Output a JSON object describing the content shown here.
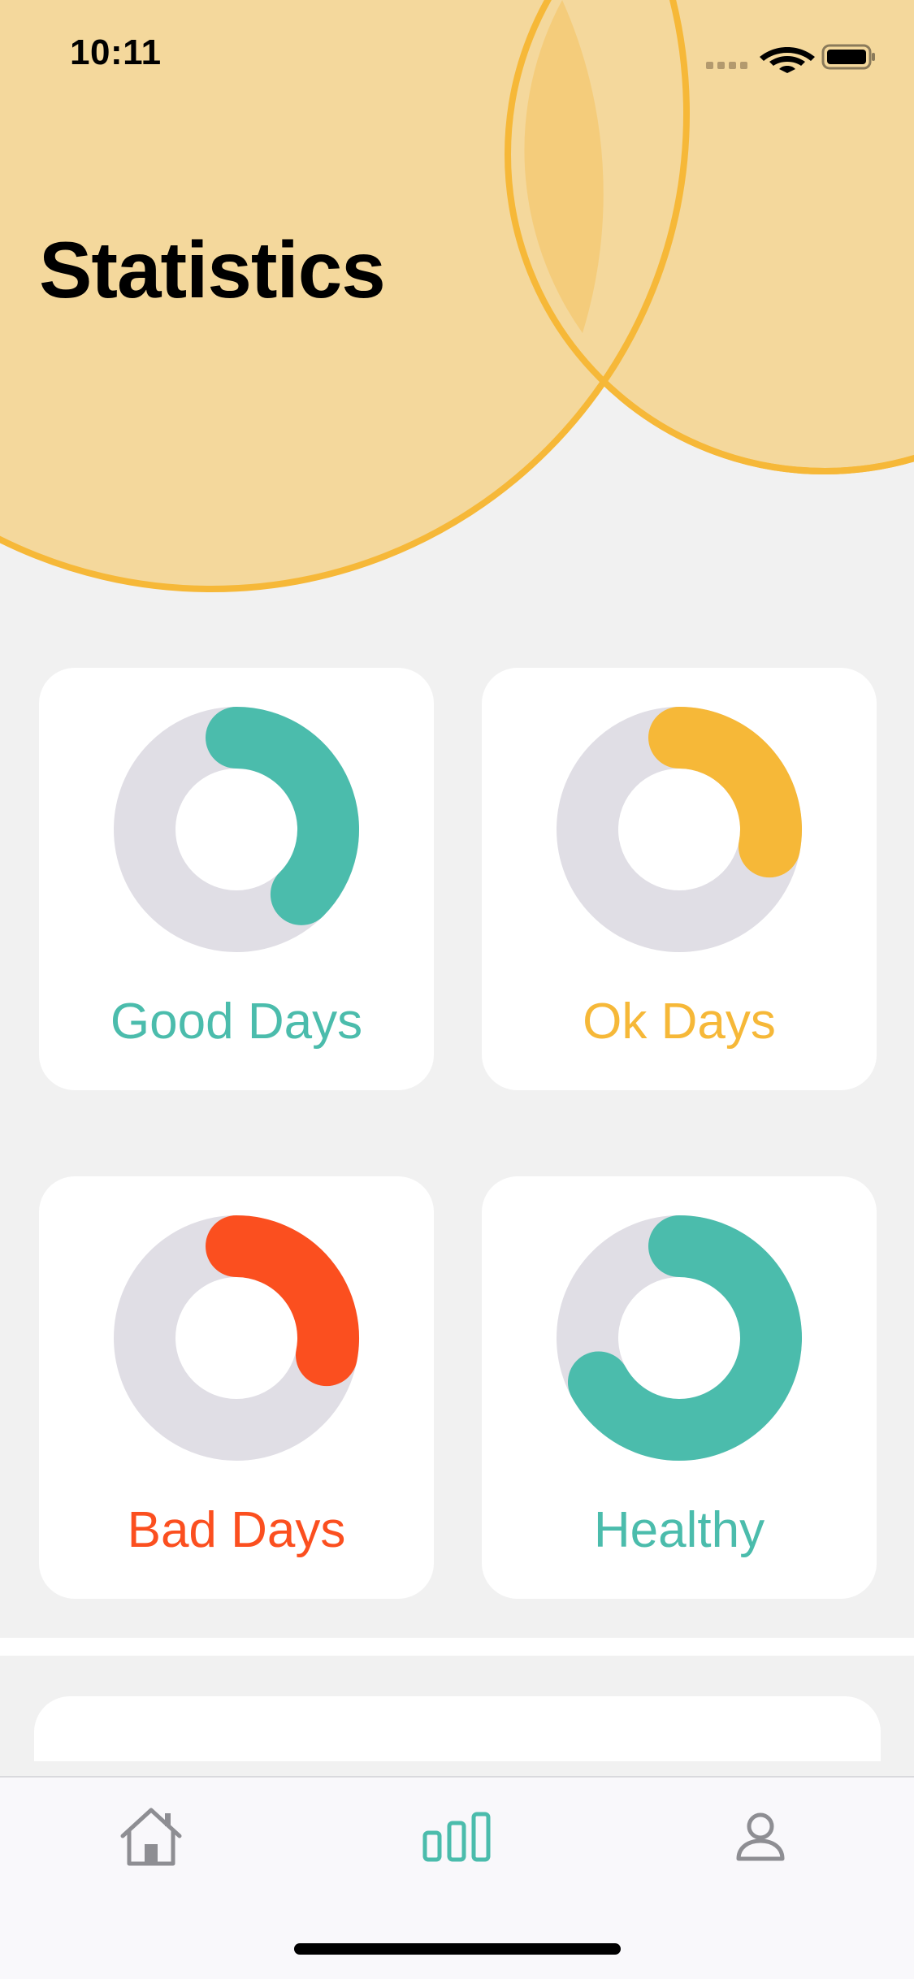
{
  "status_bar": {
    "time": "10:11"
  },
  "header": {
    "title": "Statistics"
  },
  "colors": {
    "accent_yellow": "#f6b838",
    "header_fill": "#f4d89c",
    "green": "#4bbcac",
    "red": "#fb4f1f",
    "ring_track": "#e0dee5",
    "tab_active": "#4bbcac",
    "tab_inactive": "#8e8e93"
  },
  "stats": [
    {
      "label": "Good Days",
      "fraction": 0.375,
      "color": "#4bbcac"
    },
    {
      "label": "Ok Days",
      "fraction": 0.28,
      "color": "#f6b838"
    },
    {
      "label": "Bad Days",
      "fraction": 0.28,
      "color": "#fb4f1f"
    },
    {
      "label": "Healthy",
      "fraction": 0.67,
      "color": "#4bbcac"
    }
  ],
  "tab_bar": {
    "tabs": [
      {
        "icon": "home-icon",
        "active": false
      },
      {
        "icon": "bar-chart-icon",
        "active": true
      },
      {
        "icon": "profile-icon",
        "active": false
      }
    ]
  }
}
